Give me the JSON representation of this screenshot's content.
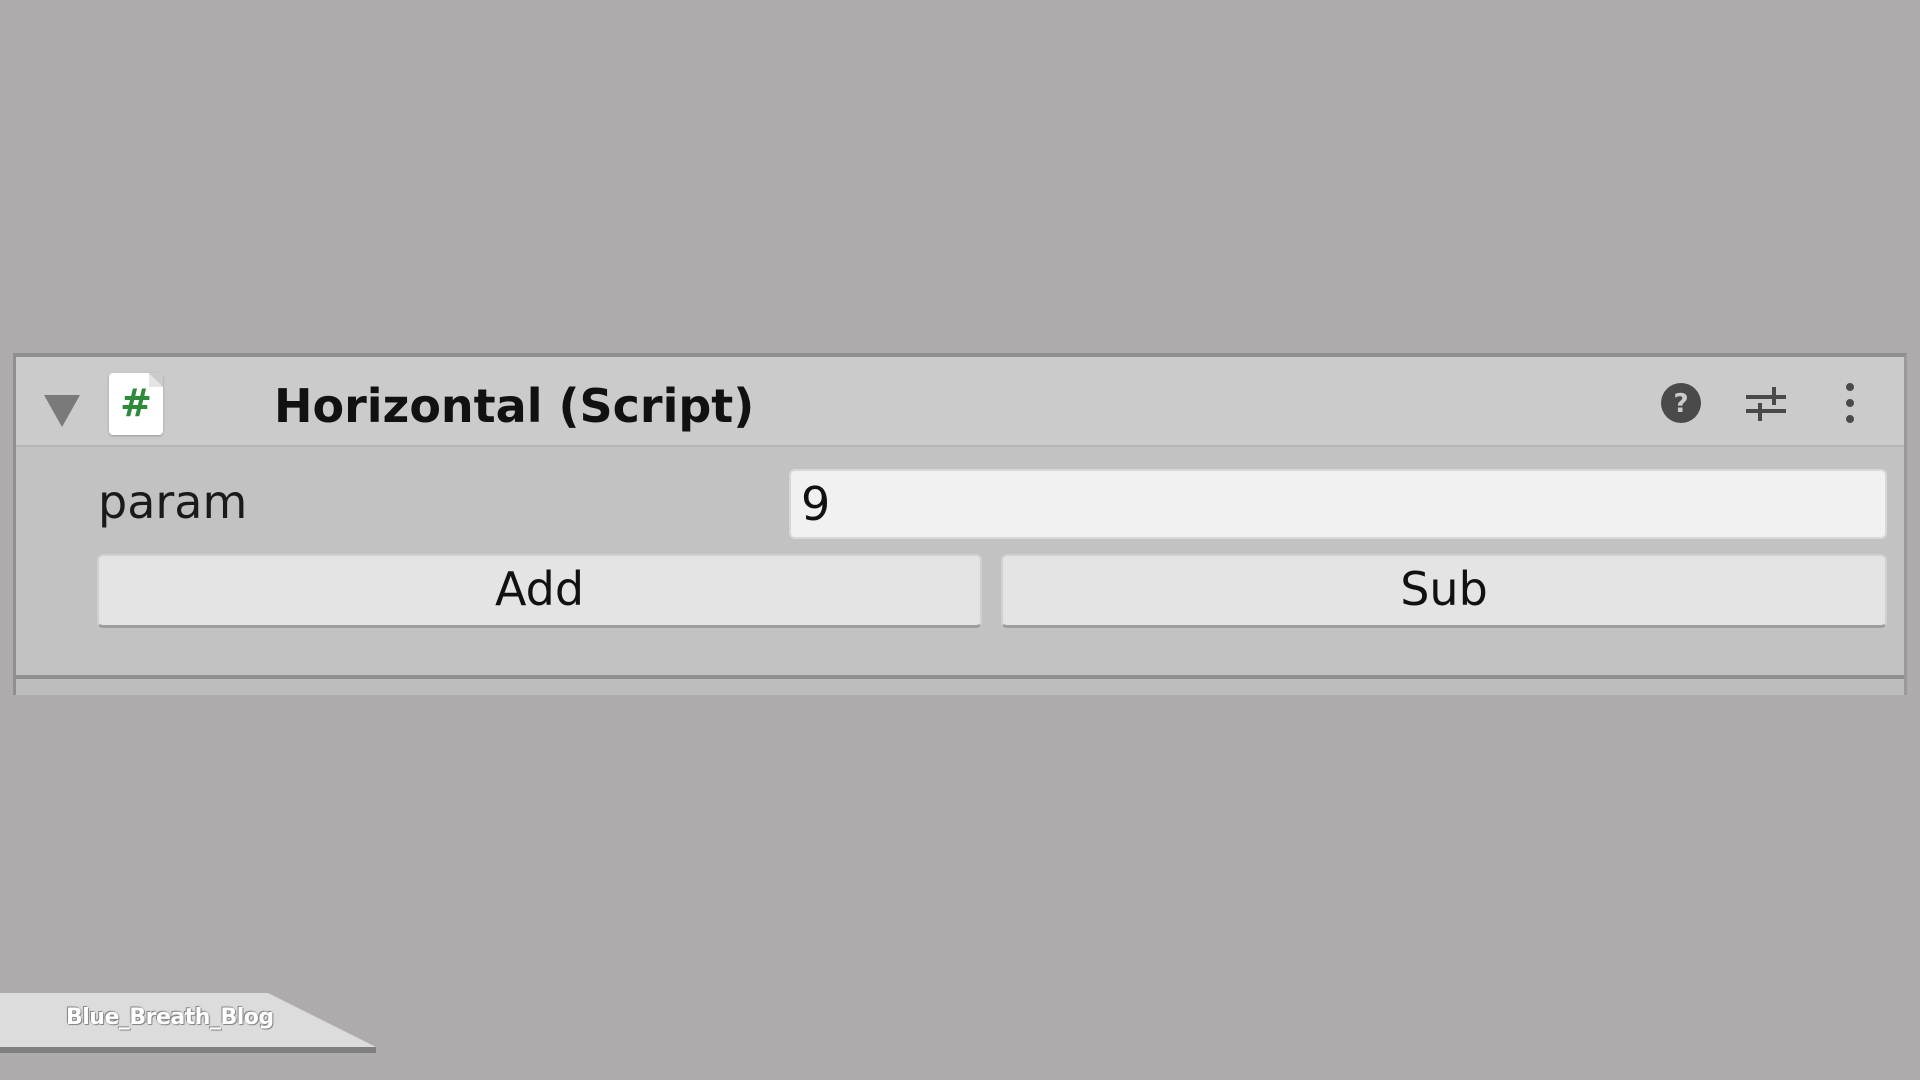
{
  "component": {
    "title": "Horizontal (Script)",
    "script_icon_glyph": "#",
    "script_icon_color": "#2e8b3a",
    "expanded": true,
    "header_icons": [
      "help-icon",
      "presets-icon",
      "more-options-icon"
    ]
  },
  "fields": {
    "param": {
      "label": "param",
      "value": "9"
    }
  },
  "buttons": {
    "add_label": "Add",
    "sub_label": "Sub"
  },
  "watermark": {
    "text": "Blue_Breath_Blog"
  },
  "colors": {
    "background": "#adabac",
    "panel": "#c2c2c2",
    "header": "#cbcbcb",
    "field": "#f1f1f1",
    "button": "#e4e4e4"
  }
}
